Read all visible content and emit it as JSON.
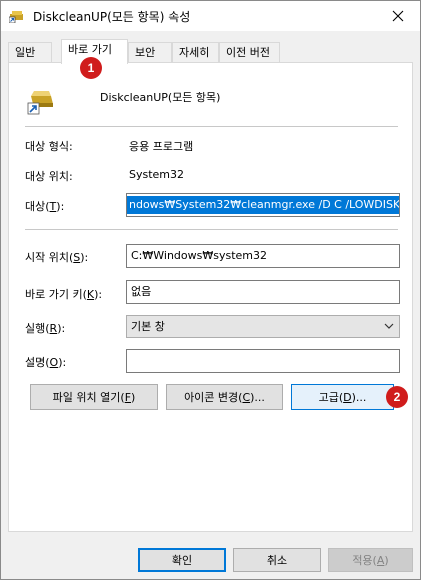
{
  "window": {
    "title": "DiskcleanUP(모든 항목) 속성"
  },
  "tabs": [
    {
      "label": "일반"
    },
    {
      "label": "바로 가기"
    },
    {
      "label": "보안"
    },
    {
      "label": "자세히"
    },
    {
      "label": "이전 버전"
    }
  ],
  "active_tab": "바로 가기",
  "badges": {
    "one": "1",
    "two": "2"
  },
  "shortcut": {
    "name": "DiskcleanUP(모든 항목)",
    "target_type_label": "대상 형식:",
    "target_type_value": "응용 프로그램",
    "target_location_label": "대상 위치:",
    "target_location_value": "System32",
    "target_label_prefix": "대상(",
    "target_label_key": "T",
    "target_label_suffix": "):",
    "target_value": "ndows₩System32₩cleanmgr.exe /D C /LOWDISK",
    "start_in_label_prefix": "시작 위치(",
    "start_in_label_key": "S",
    "start_in_label_suffix": "):",
    "start_in_value": "C:₩Windows₩system32",
    "shortcut_key_label_prefix": "바로 가기 키(",
    "shortcut_key_label_key": "K",
    "shortcut_key_label_suffix": "):",
    "shortcut_key_value": "없음",
    "run_label_prefix": "실행(",
    "run_label_key": "R",
    "run_label_suffix": "):",
    "run_value": "기본 창",
    "comment_label_prefix": "설명(",
    "comment_label_key": "O",
    "comment_label_suffix": "):",
    "comment_value": ""
  },
  "buttons": {
    "open_location_prefix": "파일 위치 열기(",
    "open_location_key": "F",
    "open_location_suffix": ")",
    "change_icon_prefix": "아이콘 변경(",
    "change_icon_key": "C",
    "change_icon_suffix": ")...",
    "advanced_prefix": "고급(",
    "advanced_key": "D",
    "advanced_suffix": ")...",
    "ok": "확인",
    "cancel": "취소",
    "apply_prefix": "적용(",
    "apply_key": "A",
    "apply_suffix": ")"
  },
  "colors": {
    "accent": "#0078d7",
    "badge": "#d01c1c"
  }
}
